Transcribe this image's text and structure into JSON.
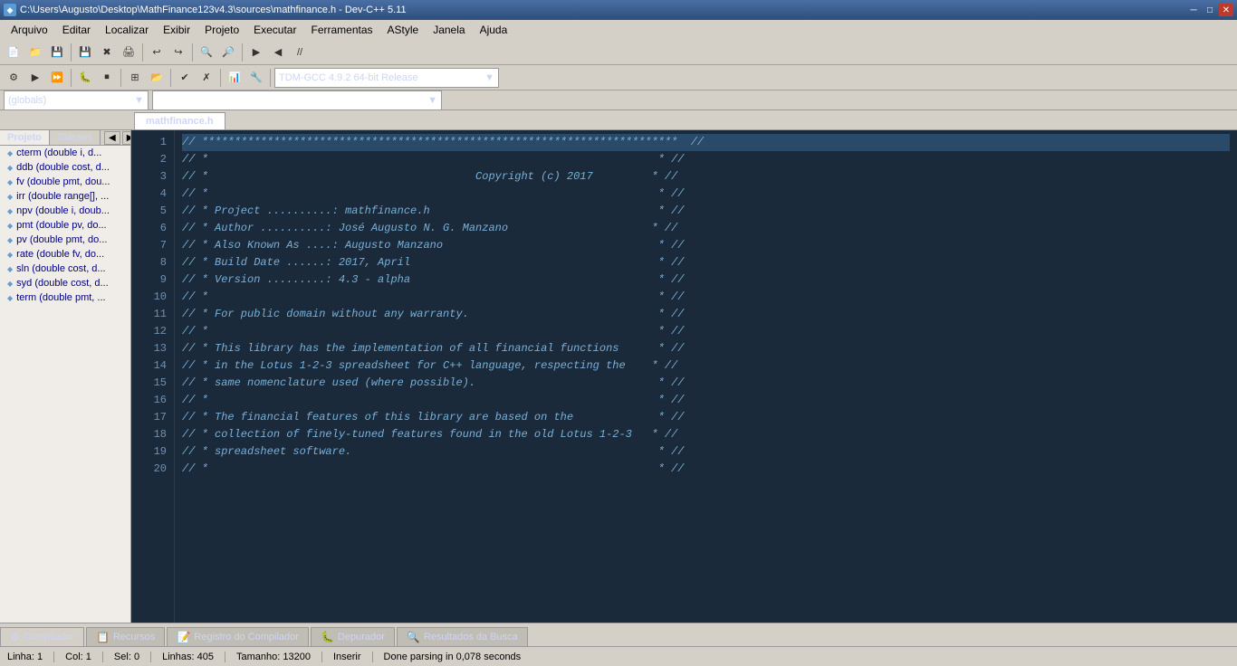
{
  "titlebar": {
    "title": "C:\\Users\\Augusto\\Desktop\\MathFinance123v4.3\\sources\\mathfinance.h - Dev-C++ 5.11",
    "icon": "◆",
    "minimize": "─",
    "maximize": "□",
    "close": "✕"
  },
  "menubar": {
    "items": [
      "Arquivo",
      "Editar",
      "Localizar",
      "Exibir",
      "Projeto",
      "Executar",
      "Ferramentas",
      "AStyle",
      "Janela",
      "Ajuda"
    ]
  },
  "toolbar1": {
    "buttons": [
      "📁",
      "💾",
      "🖨",
      "✂",
      "📋",
      "📄",
      "↩",
      "↪",
      "🔍",
      "🔎",
      "🔲",
      "🔳"
    ],
    "separator_positions": [
      3,
      7,
      9
    ]
  },
  "toolbar2": {
    "buttons": [
      "⬛",
      "⬜",
      "▶",
      "⏸",
      "⏹",
      "⛶",
      "⊞",
      "⊟",
      "✔",
      "✗",
      "📊",
      "🔧"
    ],
    "compiler_label": "TDM-GCC 4.9.2 64-bit Release"
  },
  "globals_combo": "(globals)",
  "second_combo": "",
  "tabs": {
    "file_tab": "mathfinance.h"
  },
  "sidebar": {
    "tabs": [
      "Projeto",
      "Classes"
    ],
    "nav_buttons": [
      "◀",
      "▶"
    ],
    "items": [
      "cterm (double i, d...",
      "ddb (double cost, d...",
      "fv (double pmt, dou...",
      "irr (double range[], ...",
      "npv (double i, doub...",
      "pmt (double pv, do...",
      "pv (double pmt, do...",
      "rate (double fv, do...",
      "sln (double cost, d...",
      "syd (double cost, d...",
      "term (double pmt, ..."
    ]
  },
  "editor": {
    "lines": [
      {
        "num": 1,
        "text": "// *************************************************************************  //",
        "highlighted": true
      },
      {
        "num": 2,
        "text": "// *                                                                     * //",
        "highlighted": false
      },
      {
        "num": 3,
        "text": "// *                                         Copyright (c) 2017         * //",
        "highlighted": false
      },
      {
        "num": 4,
        "text": "// *                                                                     * //",
        "highlighted": false
      },
      {
        "num": 5,
        "text": "// * Project ..........: mathfinance.h                                   * //",
        "highlighted": false
      },
      {
        "num": 6,
        "text": "// * Author ..........: José Augusto N. G. Manzano                      * //",
        "highlighted": false
      },
      {
        "num": 7,
        "text": "// * Also Known As ....: Augusto Manzano                                 * //",
        "highlighted": false
      },
      {
        "num": 8,
        "text": "// * Build Date ......: 2017, April                                      * //",
        "highlighted": false
      },
      {
        "num": 9,
        "text": "// * Version .........: 4.3 - alpha                                      * //",
        "highlighted": false
      },
      {
        "num": 10,
        "text": "// *                                                                     * //",
        "highlighted": false
      },
      {
        "num": 11,
        "text": "// * For public domain without any warranty.                             * //",
        "highlighted": false
      },
      {
        "num": 12,
        "text": "// *                                                                     * //",
        "highlighted": false
      },
      {
        "num": 13,
        "text": "// * This library has the implementation of all financial functions      * //",
        "highlighted": false
      },
      {
        "num": 14,
        "text": "// * in the Lotus 1-2-3 spreadsheet for C++ language, respecting the    * //",
        "highlighted": false
      },
      {
        "num": 15,
        "text": "// * same nomenclature used (where possible).                            * //",
        "highlighted": false
      },
      {
        "num": 16,
        "text": "// *                                                                     * //",
        "highlighted": false
      },
      {
        "num": 17,
        "text": "// * The financial features of this library are based on the             * //",
        "highlighted": false
      },
      {
        "num": 18,
        "text": "// * collection of finely-tuned features found in the old Lotus 1-2-3   * //",
        "highlighted": false
      },
      {
        "num": 19,
        "text": "// * spreadsheet software.                                               * //",
        "highlighted": false
      },
      {
        "num": 20,
        "text": "// *                                                                     * //",
        "highlighted": false
      }
    ]
  },
  "bottom_tabs": [
    {
      "label": "Compilador",
      "icon": "⚙"
    },
    {
      "label": "Recursos",
      "icon": "📋"
    },
    {
      "label": "Registro do Compilador",
      "icon": "📝"
    },
    {
      "label": "Depurador",
      "icon": "🐛"
    },
    {
      "label": "Resultados da Busca",
      "icon": "🔍"
    }
  ],
  "statusbar": {
    "line_label": "Linha:",
    "line_value": "1",
    "col_label": "Col:",
    "col_value": "1",
    "sel_label": "Sel:",
    "sel_value": "0",
    "lines_label": "Linhas:",
    "lines_value": "405",
    "size_label": "Tamanho:",
    "size_value": "13200",
    "insert_label": "Inserir",
    "status_msg": "Done parsing in 0,078 seconds"
  }
}
